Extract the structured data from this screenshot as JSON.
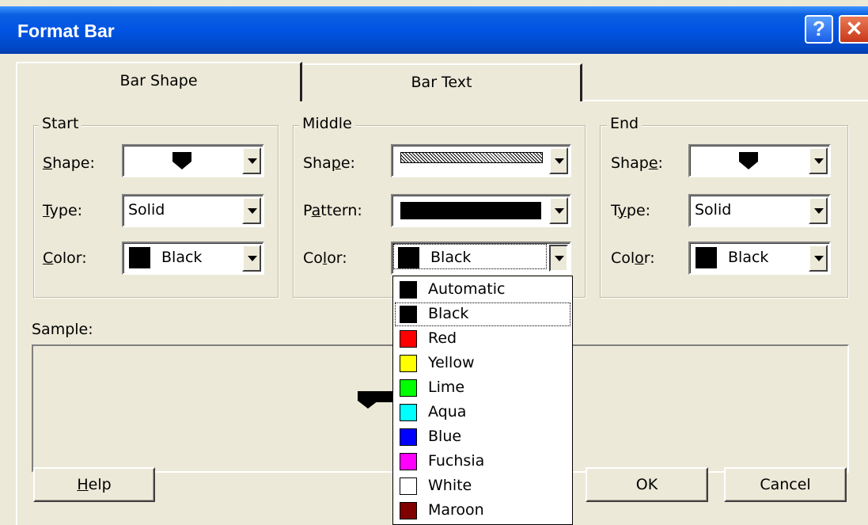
{
  "window": {
    "title": "Format Bar",
    "help_glyph": "?",
    "close_glyph": "✕"
  },
  "tabs": [
    {
      "label": "Bar Shape",
      "active": true
    },
    {
      "label": "Bar Text",
      "active": false
    }
  ],
  "start": {
    "group_label": "Start",
    "shape_label_pre": "S",
    "shape_label_post": "hape:",
    "type_label_pre": "T",
    "type_label_post": "ype:",
    "type_value": "Solid",
    "color_label_pre": "C",
    "color_label_post": "olor:",
    "color_value": "Black",
    "color_hex": "#000000"
  },
  "middle": {
    "group_label": "Middle",
    "shape_label_pre": "Sha",
    "shape_label_mn": "p",
    "shape_label_post": "e:",
    "pattern_label_pre": "P",
    "pattern_label_mn": "a",
    "pattern_label_post": "ttern:",
    "color_label_pre": "Co",
    "color_label_mn": "l",
    "color_label_post": "or:",
    "color_value": "Black",
    "color_hex": "#000000"
  },
  "end": {
    "group_label": "End",
    "shape_label_pre": "Shap",
    "shape_label_mn": "e",
    "shape_label_post": ":",
    "type_label_pre": "T",
    "type_label_mn": "y",
    "type_label_post": "pe:",
    "type_value": "Solid",
    "color_label_pre": "Col",
    "color_label_mn": "o",
    "color_label_post": "r:",
    "color_value": "Black",
    "color_hex": "#000000"
  },
  "sample": {
    "label": "Sample:"
  },
  "buttons": {
    "help_mn": "H",
    "help_rest": "elp",
    "ok": "OK",
    "cancel": "Cancel"
  },
  "color_dropdown": {
    "selected": "Black",
    "options": [
      {
        "label": "Automatic",
        "hex": "#000000"
      },
      {
        "label": "Black",
        "hex": "#000000"
      },
      {
        "label": "Red",
        "hex": "#ff0000"
      },
      {
        "label": "Yellow",
        "hex": "#ffff00"
      },
      {
        "label": "Lime",
        "hex": "#00ff00"
      },
      {
        "label": "Aqua",
        "hex": "#00ffff"
      },
      {
        "label": "Blue",
        "hex": "#0000ff"
      },
      {
        "label": "Fuchsia",
        "hex": "#ff00ff"
      },
      {
        "label": "White",
        "hex": "#ffffff"
      },
      {
        "label": "Maroon",
        "hex": "#800000"
      }
    ]
  }
}
